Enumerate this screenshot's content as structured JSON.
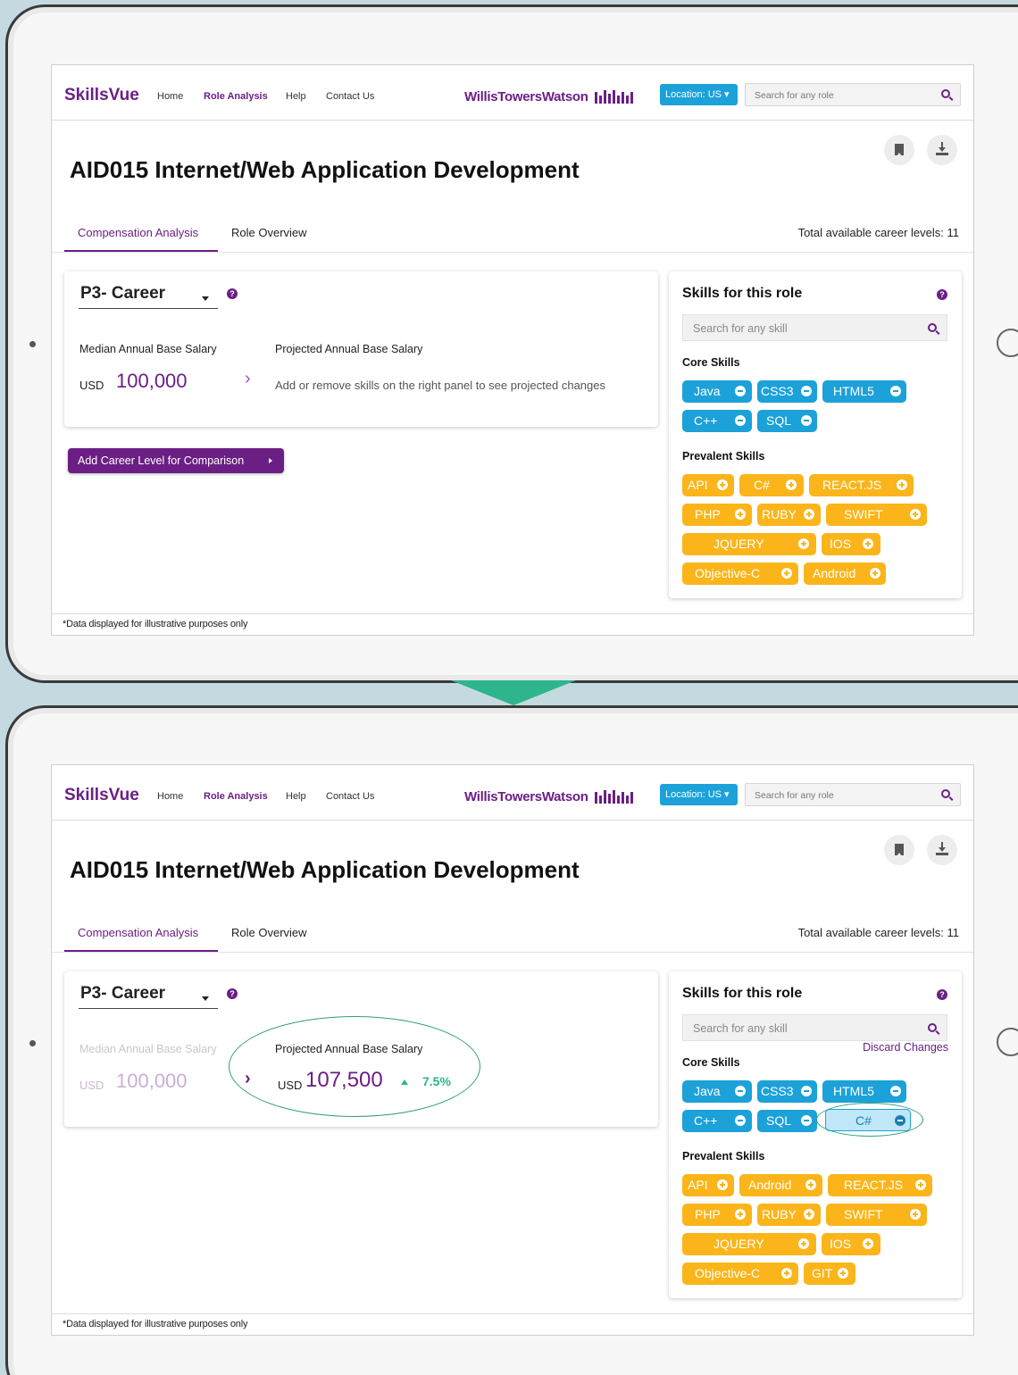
{
  "nav": {
    "brand": "SkillsVue",
    "links": [
      "Home",
      "Role Analysis",
      "Help",
      "Contact Us"
    ],
    "partner": "WillisTowersWatson",
    "location_button": "Location: US",
    "role_search_placeholder": "Search for any role"
  },
  "page_title": "AID015 Internet/Web Application Development",
  "tabs": [
    "Compensation Analysis",
    "Role Overview"
  ],
  "career_levels_text": "Total available career levels: 11",
  "compensation": {
    "level": "P3- Career",
    "help": "?",
    "median_label": "Median Annual Base Salary",
    "projected_label": "Projected Annual Base Salary",
    "currency": "USD",
    "median_amount": "100,000",
    "chevron": "›",
    "hint": "Add or remove skills on the right panel to see projected changes",
    "projected_currency": "USD",
    "projected_amount": "107,500",
    "projected_change": "7.5%"
  },
  "add_level_button": "Add Career Level for Comparison",
  "skills_panel": {
    "title": "Skills for this role",
    "search_placeholder": "Search for any skill",
    "core_label": "Core Skills",
    "prevalent_label": "Prevalent Skills",
    "discard_changes": "Discard Changes",
    "before": {
      "core": [
        "Java",
        "CSS3",
        "HTML5",
        "C++",
        "SQL"
      ],
      "prevalent": [
        "API",
        "C#",
        "REACT.JS",
        "PHP",
        "RUBY",
        "SWIFT",
        "JQUERY",
        "IOS",
        "Objective-C",
        "Android"
      ]
    },
    "after": {
      "core": [
        "Java",
        "CSS3",
        "HTML5",
        "C++",
        "SQL",
        "C#"
      ],
      "prevalent": [
        "API",
        "Android",
        "REACT.JS",
        "PHP",
        "RUBY",
        "SWIFT",
        "JQUERY",
        "IOS",
        "Objective-C",
        "GIT"
      ]
    }
  },
  "footer_note": "*Data displayed for illustrative purposes only",
  "colors": {
    "brand_purple": "#6b1f84",
    "core_blue": "#1ca1d9",
    "prevalent_orange": "#fbb51a",
    "positive_green": "#2eb58c",
    "background": "#c4dae0"
  }
}
